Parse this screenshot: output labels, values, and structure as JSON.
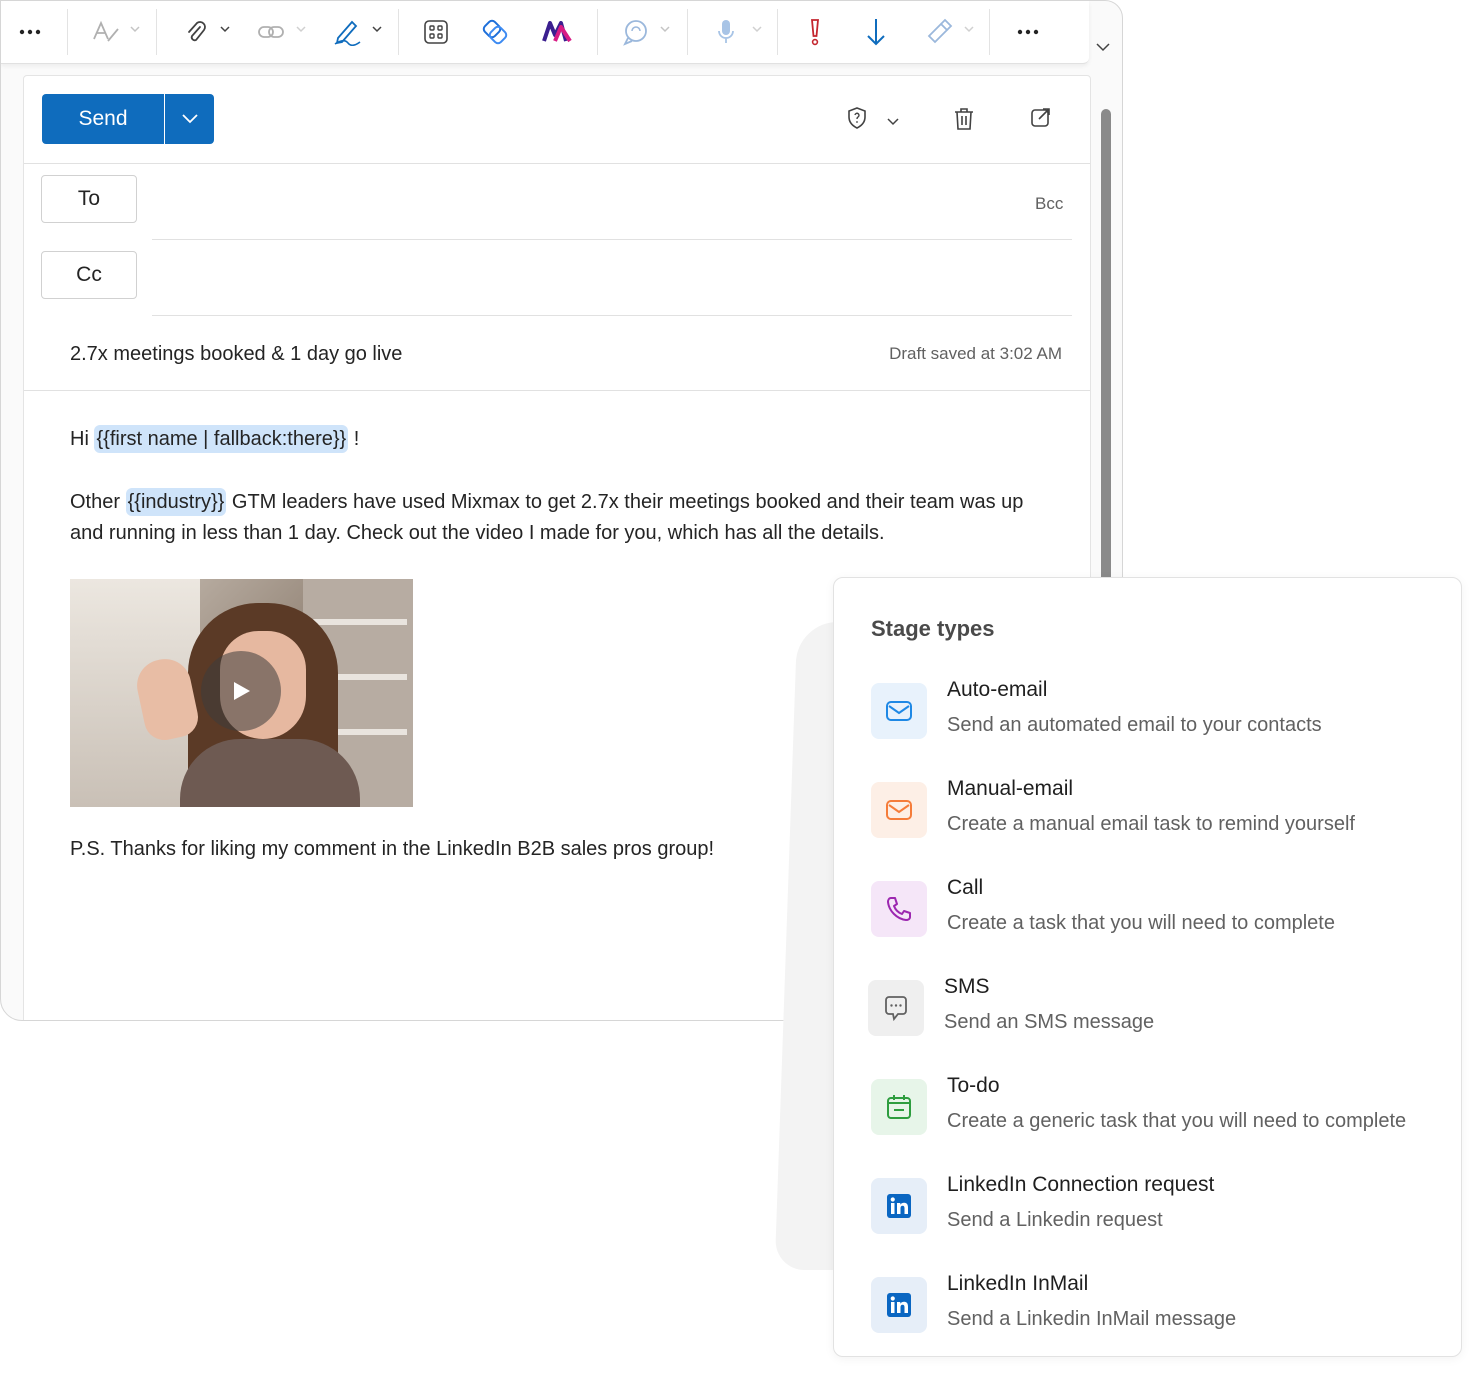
{
  "compose": {
    "send_label": "Send",
    "to_label": "To",
    "cc_label": "Cc",
    "bcc_label": "Bcc",
    "subject": "2.7x meetings booked & 1 day go live",
    "draft_status": "Draft saved at 3:02 AM",
    "body": {
      "greeting_prefix": "Hi",
      "greeting_tag": "{{first name | fallback:there}}",
      "greeting_suffix": " !",
      "p2_prefix": "Other",
      "p2_tag": "{{industry}}",
      "p2_suffix": " GTM leaders have used Mixmax to get 2.7x their meetings booked and their team was up and running in less than 1 day. Check out the video I made for you, which has all the details.",
      "ps": "P.S. Thanks for liking my comment in the LinkedIn B2B sales pros group!"
    }
  },
  "toolbar": {
    "more_icon": "more-icon",
    "icons": [
      "text-format-icon",
      "attach-icon",
      "link-icon",
      "signature-icon",
      "apps-icon",
      "loop-icon",
      "mixmax-icon",
      "copilot-icon",
      "dictate-icon",
      "importance-icon",
      "low-importance-icon",
      "sensitivity-icon",
      "more-icon"
    ]
  },
  "stage_panel": {
    "title": "Stage types",
    "items": [
      {
        "title": "Auto-email",
        "desc": "Send an automated email to your contacts",
        "icon": "mail-icon",
        "color": "#1e88e5",
        "bg": "#e8f2fc"
      },
      {
        "title": "Manual-email",
        "desc": "Create a manual email task to remind yourself",
        "icon": "mail-icon",
        "color": "#f57c3a",
        "bg": "#fdefe6"
      },
      {
        "title": "Call",
        "desc": "Create a task that you will need to complete",
        "icon": "phone-icon",
        "color": "#9c27b0",
        "bg": "#f5e6f8"
      },
      {
        "title": "SMS",
        "desc": "Send an SMS message",
        "icon": "chat-icon",
        "color": "#616161",
        "bg": "#efefef"
      },
      {
        "title": "To-do",
        "desc": "Create a generic task that you will need to complete",
        "icon": "calendar-icon",
        "color": "#2e9d3f",
        "bg": "#e7f5e9"
      },
      {
        "title": "LinkedIn Connection request",
        "desc": "Send a Linkedin request",
        "icon": "linkedin-icon",
        "color": "#0a66c2",
        "bg": "#e6eef8"
      },
      {
        "title": "LinkedIn InMail",
        "desc": "Send a Linkedin InMail message",
        "icon": "linkedin-icon",
        "color": "#0a66c2",
        "bg": "#e6eef8"
      }
    ]
  }
}
